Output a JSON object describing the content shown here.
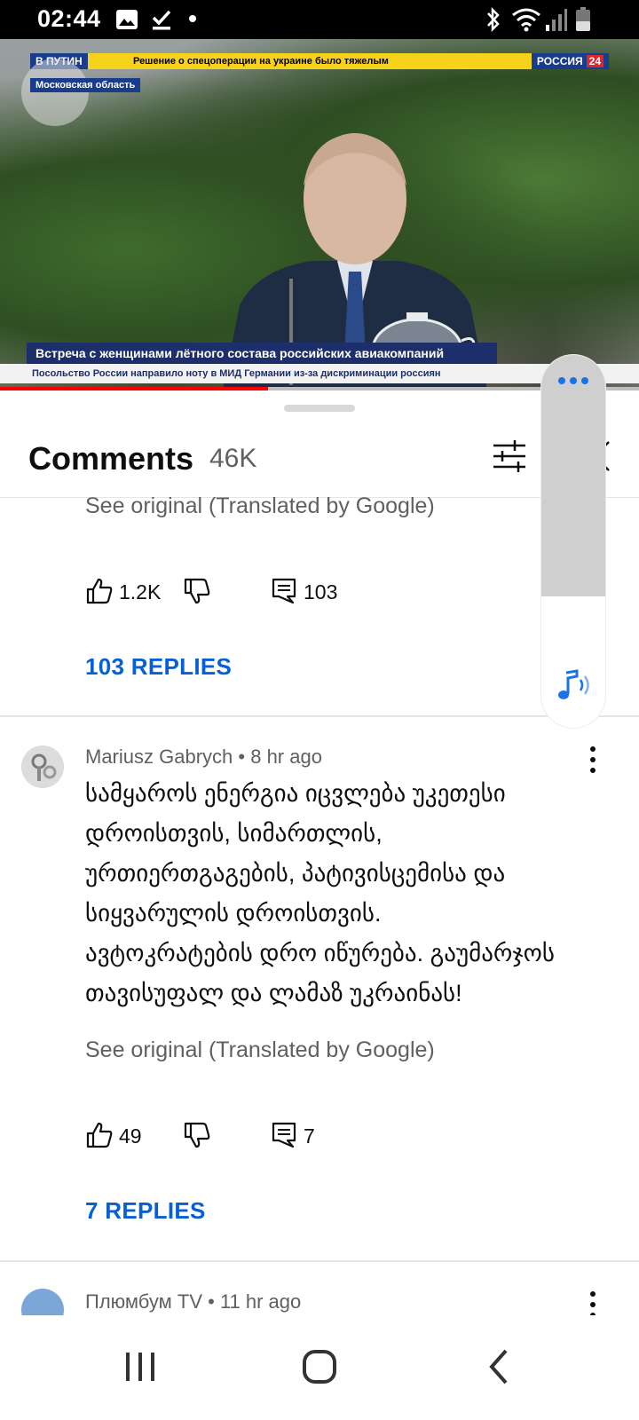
{
  "status_bar": {
    "time": "02:44",
    "left_icons": [
      "gallery-icon",
      "check-icon",
      "dot-icon"
    ],
    "right_icons": [
      "bluetooth-icon",
      "wifi-icon",
      "signal-icon",
      "battery-icon"
    ]
  },
  "video": {
    "ticker_tag": "В ПУТИН",
    "ticker_headline": "Решение о спецоперации на украине было тяжелым",
    "channel": "РОССИЯ",
    "channel_number": "24",
    "region": "Московская область",
    "lower_third": "Встреча с женщинами лётного состава российских авиакомпаний",
    "sub_ticker": "Посольство России направило ноту в МИД Германии из-за дискриминации россиян",
    "progress_fraction": 0.42
  },
  "comments_panel": {
    "title": "Comments",
    "count": "46K"
  },
  "thread_1": {
    "see_original": "See original (Translated by Google)",
    "likes": "1.2K",
    "reply_count": "103",
    "replies_link": "103 REPLIES"
  },
  "comment_2": {
    "author": "Mariusz Gabrych",
    "time": "8 hr ago",
    "body_lines": [
      "სამყაროს ენერგია იცვლება უკეთესი",
      "დროისთვის, სიმართლის,",
      "ურთიერთგაგების, პატივისცემისა და",
      "სიყვარულის დროისთვის.",
      "ავტოკრატების დრო იწურება. გაუმარჯოს",
      "თავისუფალ და ლამაზ უკრაინას!"
    ],
    "see_original": "See original (Translated by Google)",
    "likes": "49",
    "reply_count": "7",
    "replies_link": "7 REPLIES"
  },
  "comment_3": {
    "author": "Плюмбум TV",
    "time": "11 hr ago"
  },
  "colors": {
    "accent_blue": "#065fd4",
    "progress_red": "#ff0000",
    "secondary_text": "#606060"
  }
}
